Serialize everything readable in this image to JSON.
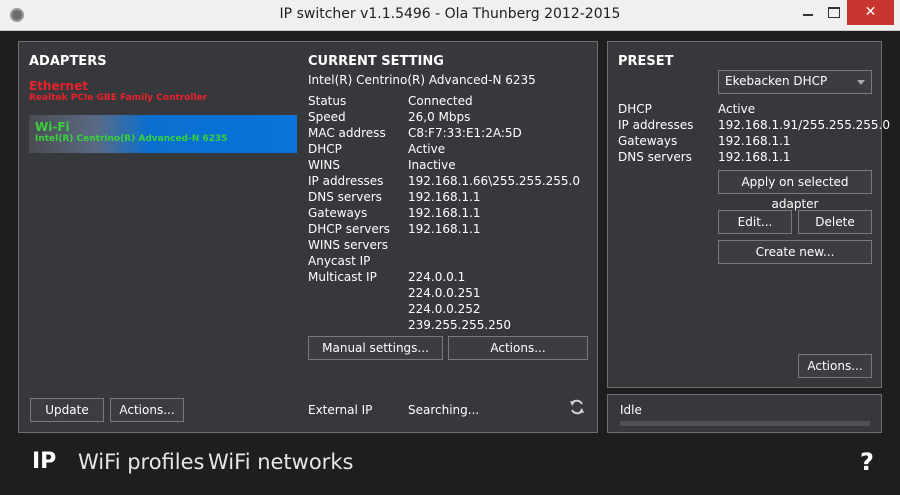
{
  "window": {
    "title": "IP switcher v1.1.5496 - Ola Thunberg 2012-2015",
    "close_glyph": "✕"
  },
  "adapters": {
    "heading": "ADAPTERS",
    "items": [
      {
        "name": "Ethernet",
        "description": "Realtek PCIe GBE Family Controller"
      },
      {
        "name": "Wi-Fi",
        "description": "Intel(R) Centrino(R) Advanced-N 6235"
      }
    ],
    "update_label": "Update",
    "actions_label": "Actions..."
  },
  "current": {
    "heading": "CURRENT SETTING",
    "adapter": "Intel(R) Centrino(R) Advanced-N 6235",
    "fields": [
      {
        "key": "Status",
        "value": "Connected"
      },
      {
        "key": "Speed",
        "value": "26,0 Mbps"
      },
      {
        "key": "MAC address",
        "value": "C8:F7:33:E1:2A:5D"
      },
      {
        "key": "DHCP",
        "value": "Active"
      },
      {
        "key": "WINS",
        "value": "Inactive"
      },
      {
        "key": "IP addresses",
        "value": "192.168.1.66\\255.255.255.0"
      },
      {
        "key": "DNS servers",
        "value": "192.168.1.1"
      },
      {
        "key": "Gateways",
        "value": "192.168.1.1"
      },
      {
        "key": "DHCP servers",
        "value": "192.168.1.1"
      },
      {
        "key": "WINS servers",
        "value": ""
      },
      {
        "key": "Anycast IP",
        "value": ""
      },
      {
        "key": "Multicast IP",
        "value": "224.0.0.1"
      },
      {
        "key": "",
        "value": "224.0.0.251"
      },
      {
        "key": "",
        "value": "224.0.0.252"
      },
      {
        "key": "",
        "value": "239.255.255.250"
      }
    ],
    "manual_label": "Manual settings...",
    "actions_label": "Actions...",
    "external_ip_label": "External IP",
    "external_ip_value": "Searching..."
  },
  "preset": {
    "heading": "PRESET",
    "selected": "Ekebacken DHCP",
    "fields": [
      {
        "key": "DHCP",
        "value": "Active"
      },
      {
        "key": "IP addresses",
        "value": "192.168.1.91/255.255.255.0"
      },
      {
        "key": "Gateways",
        "value": "192.168.1.1"
      },
      {
        "key": "DNS servers",
        "value": "192.168.1.1"
      }
    ],
    "apply_label": "Apply on selected adapter",
    "edit_label": "Edit...",
    "delete_label": "Delete",
    "create_label": "Create new...",
    "actions_label": "Actions..."
  },
  "status": {
    "text": "Idle",
    "progress": 0
  },
  "nav": {
    "ip": "IP",
    "wifi_profiles": "WiFi profiles",
    "wifi_networks": "WiFi networks",
    "help": "?"
  },
  "colors": {
    "ethernet": "#e8222a",
    "wifi": "#39d23a",
    "selected": "#0a74da",
    "panel": "#37383c"
  }
}
